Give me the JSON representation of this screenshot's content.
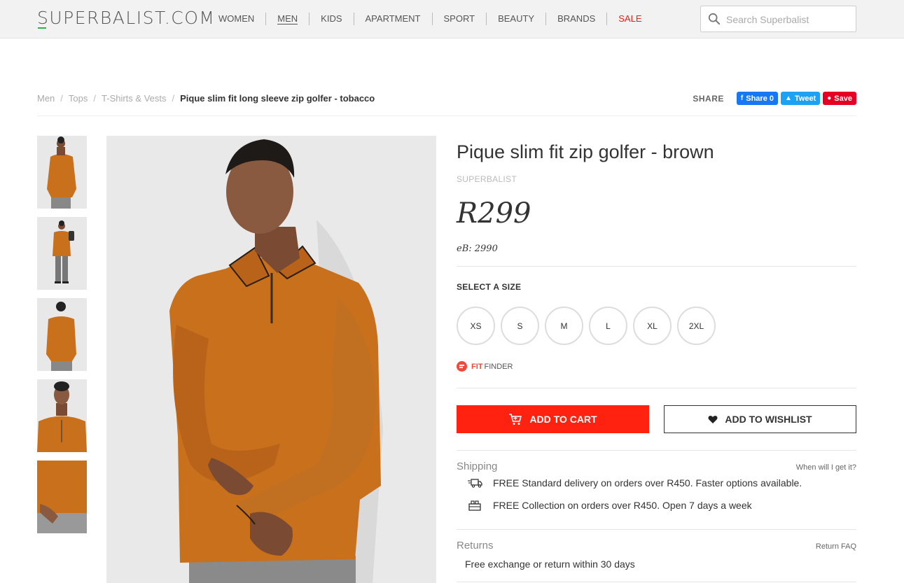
{
  "header": {
    "logo": "SUPERBALIST.COM",
    "nav": [
      "WOMEN",
      "MEN",
      "KIDS",
      "APARTMENT",
      "SPORT",
      "BEAUTY",
      "BRANDS",
      "SALE"
    ],
    "search_placeholder": "Search Superbalist"
  },
  "breadcrumb": {
    "items": [
      "Men",
      "Tops",
      "T-Shirts & Vests"
    ],
    "current": "Pique slim fit long sleeve zip golfer - tobacco"
  },
  "share": {
    "label": "SHARE",
    "facebook": "Share 0",
    "twitter": "Tweet",
    "pinterest": "Save"
  },
  "product": {
    "title": "Pique slim fit zip golfer - brown",
    "brand": "SUPERBALIST",
    "price": "R299",
    "ebucks": "eB: 2990",
    "size_label": "SELECT A SIZE",
    "sizes": [
      "XS",
      "S",
      "M",
      "L",
      "XL",
      "2XL"
    ],
    "fit_finder_brand": "FIT",
    "fit_finder_label": "FINDER",
    "add_to_cart": "ADD TO CART",
    "add_to_wishlist": "ADD TO WISHLIST"
  },
  "shipping": {
    "title": "Shipping",
    "link": "When will I get it?",
    "rows": [
      "FREE Standard delivery on orders over R450. Faster options available.",
      "FREE Collection on orders over R450. Open 7 days a week"
    ]
  },
  "returns": {
    "title": "Returns",
    "link": "Return FAQ",
    "text": "Free exchange or return within 30 days"
  },
  "colors": {
    "accent_red": "#ff2211",
    "logo_green": "#2bb24c",
    "shirt_orange": "#c8701c"
  }
}
